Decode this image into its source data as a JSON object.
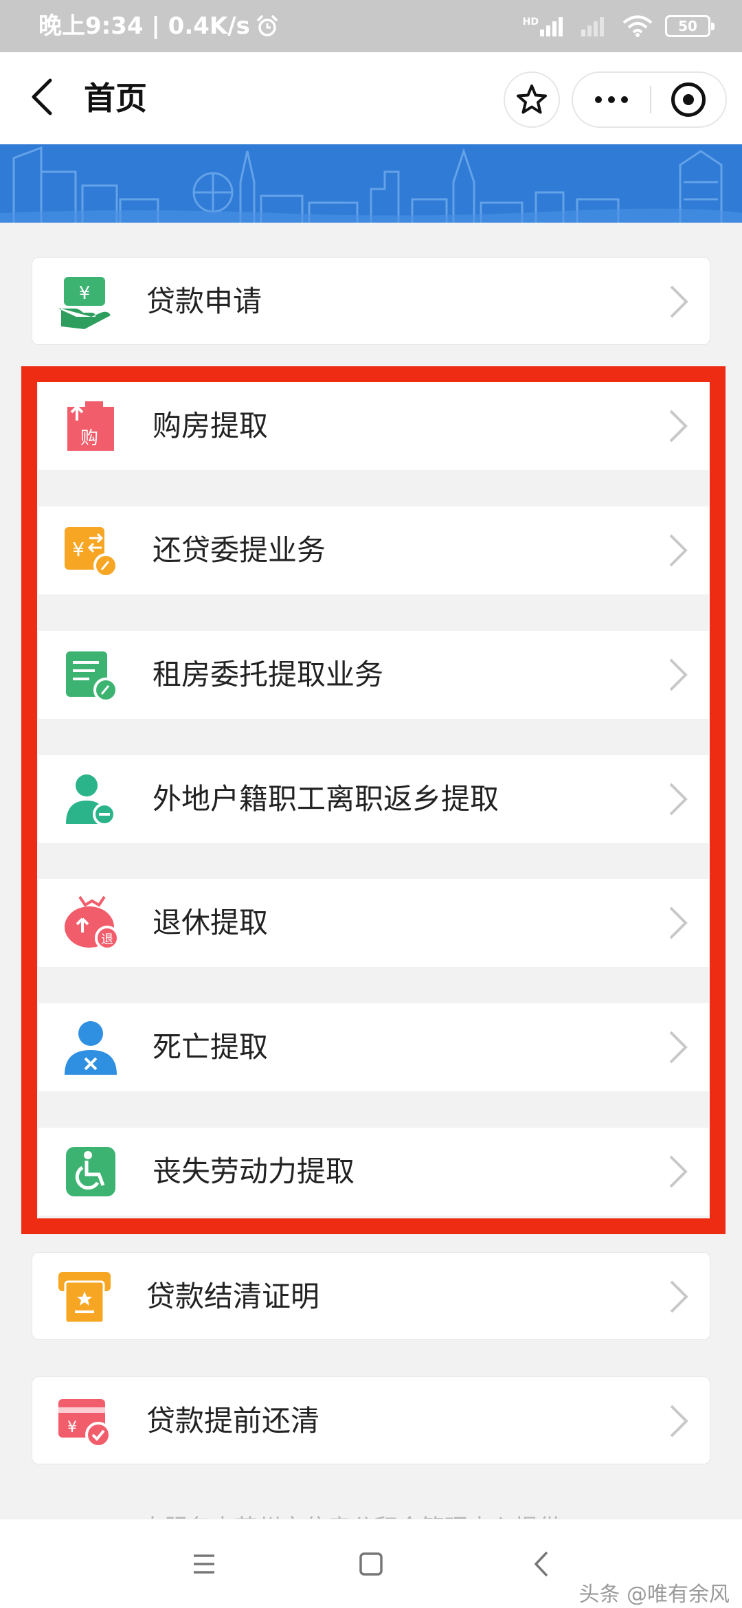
{
  "status_bar": {
    "time_speed": "晚上9:34 | 0.4K/s",
    "hd": "HD",
    "battery": "50"
  },
  "nav": {
    "title": "首页"
  },
  "top_items": [
    {
      "label": "贷款申请",
      "icon": "loan-apply-icon",
      "color": "#3cb371"
    }
  ],
  "highlighted_items": [
    {
      "label": "购房提取",
      "icon": "house-purchase-icon",
      "color": "#f25d6b"
    },
    {
      "label": "还贷委提业务",
      "icon": "loan-repay-icon",
      "color": "#f6a623"
    },
    {
      "label": "租房委托提取业务",
      "icon": "rent-document-icon",
      "color": "#3cb371"
    },
    {
      "label": "外地户籍职工离职返乡提取",
      "icon": "user-minus-icon",
      "color": "#2bb38a"
    },
    {
      "label": "退休提取",
      "icon": "retirement-bag-icon",
      "color": "#f25d6b"
    },
    {
      "label": "死亡提取",
      "icon": "user-x-icon",
      "color": "#2f8fe0"
    },
    {
      "label": "丧失劳动力提取",
      "icon": "wheelchair-icon",
      "color": "#3cb371"
    }
  ],
  "bottom_items": [
    {
      "label": "贷款结清证明",
      "icon": "certificate-icon",
      "color": "#f6a623"
    },
    {
      "label": "贷款提前还清",
      "icon": "card-check-icon",
      "color": "#f25d6b"
    }
  ],
  "footer_note": "本服务由苏州市住房公积金管理中心提供",
  "watermark": "头条 @唯有余风",
  "colors": {
    "highlight": "#ee2c14",
    "banner": "#2f7bd6"
  }
}
